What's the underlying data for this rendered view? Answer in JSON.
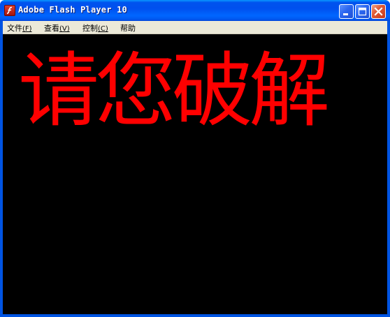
{
  "window": {
    "title": "Adobe Flash Player 10",
    "icon": "flash-player-icon",
    "controls": {
      "minimize_icon": "minimize-icon",
      "maximize_icon": "maximize-icon",
      "close_icon": "close-icon"
    }
  },
  "menubar": {
    "items": [
      {
        "label": "文件",
        "accel": "(F)"
      },
      {
        "label": "查看",
        "accel": "(V)"
      },
      {
        "label": "控制",
        "accel": "(C)"
      },
      {
        "label": "帮助",
        "accel": ""
      }
    ]
  },
  "stage": {
    "text": "请您破解",
    "text_color": "#ff0000",
    "background": "#000000"
  },
  "colors": {
    "titlebar": "#0054e3",
    "menubar": "#ece9d8"
  }
}
